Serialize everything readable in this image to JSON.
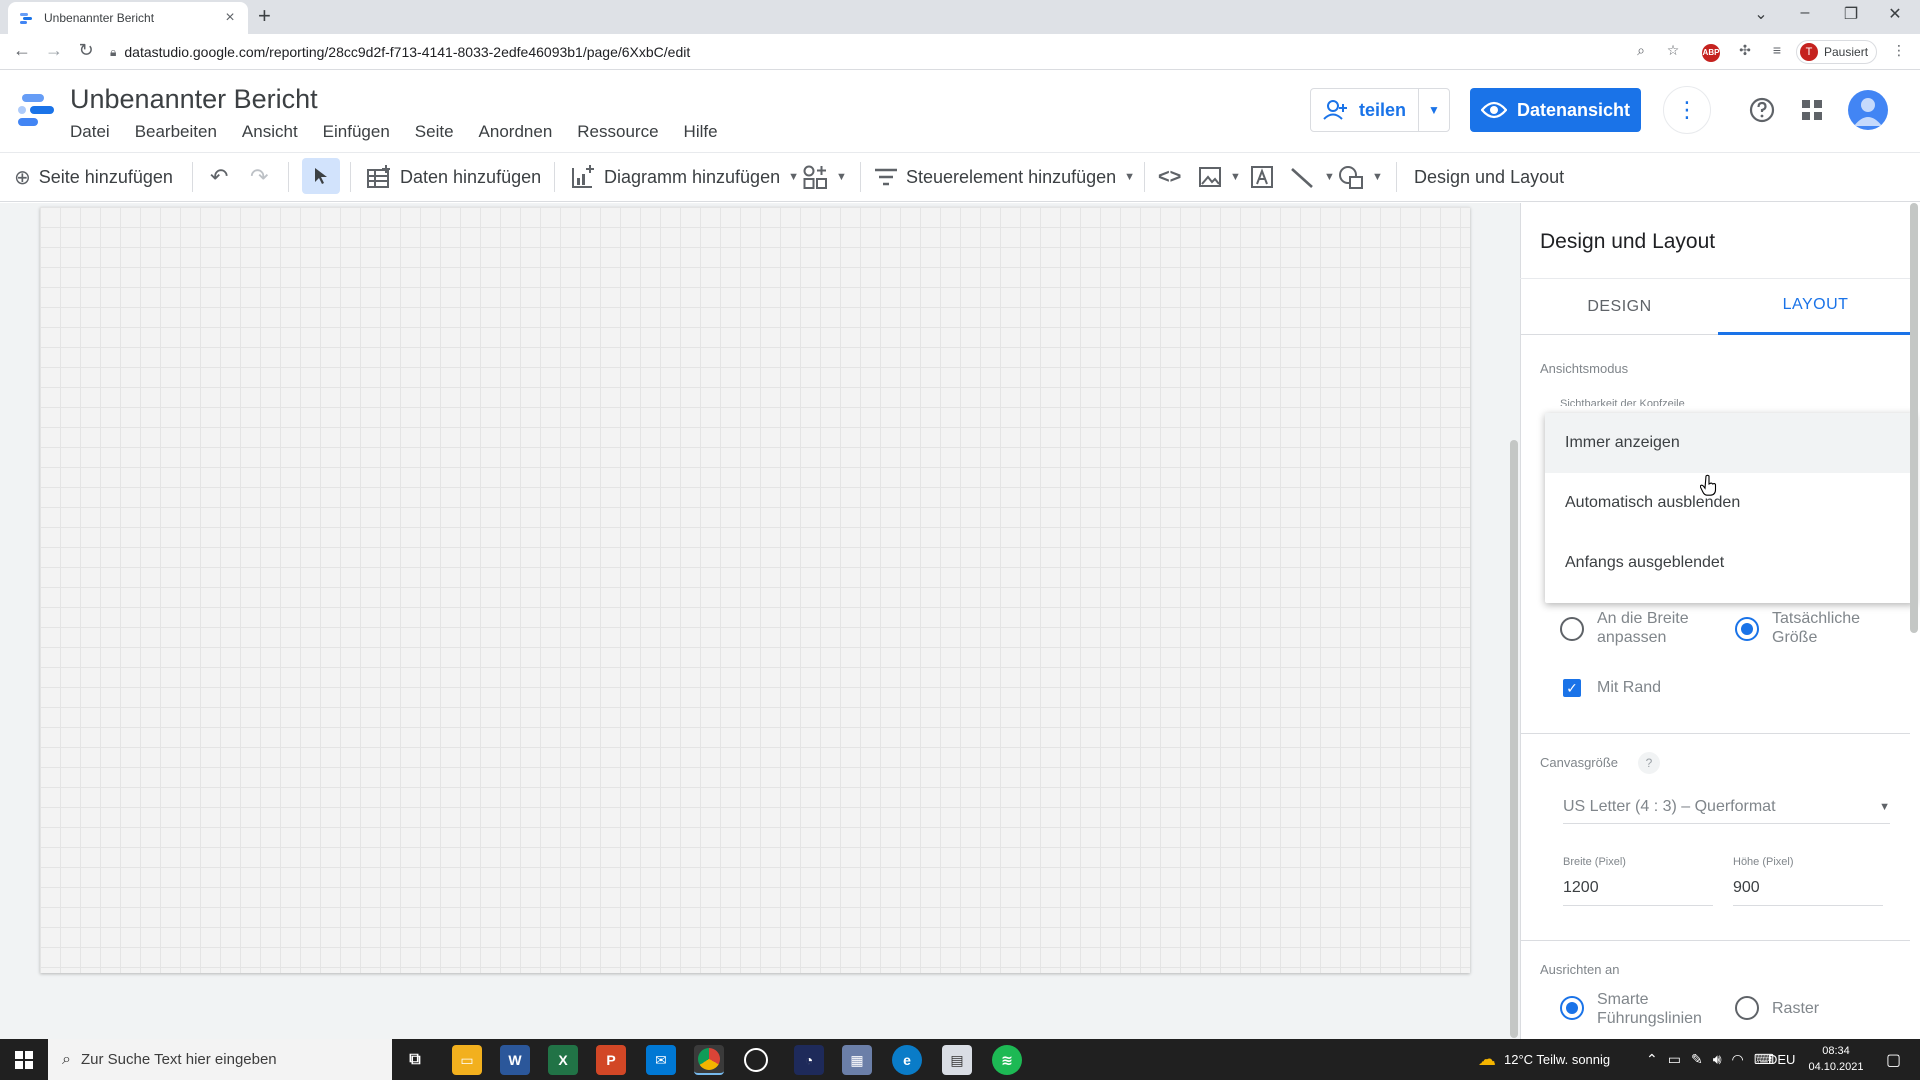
{
  "browser": {
    "tab_title": "Unbenannter Bericht",
    "url": "datastudio.google.com/reporting/28cc9d2f-f713-4141-8033-2edfe46093b1/page/6XxbC/edit",
    "profile_status": "Pausiert",
    "profile_initial": "T"
  },
  "app": {
    "report_title": "Unbenannter Bericht",
    "menu": [
      "Datei",
      "Bearbeiten",
      "Ansicht",
      "Einfügen",
      "Seite",
      "Anordnen",
      "Ressource",
      "Hilfe"
    ],
    "share_label": "teilen",
    "data_view_label": "Datenansicht"
  },
  "toolbar": {
    "add_page": "Seite hinzufügen",
    "add_data": "Daten hinzufügen",
    "add_chart": "Diagramm hinzufügen",
    "add_control": "Steuerelement hinzufügen",
    "theme_layout": "Design und Layout"
  },
  "panel": {
    "title": "Design und Layout",
    "tabs": [
      "DESIGN",
      "LAYOUT"
    ],
    "active_tab": "LAYOUT",
    "view_mode_label": "Ansichtsmodus",
    "header_visibility_label": "Sichtbarkeit der Kopfzeile",
    "dropdown_options": [
      "Immer anzeigen",
      "Automatisch ausblenden",
      "Anfangs ausgeblendet"
    ],
    "display_mode": {
      "option_fit_width": "An die Breite anpassen",
      "option_actual_size": "Tatsächliche Größe",
      "selected": "Tatsächliche Größe"
    },
    "with_border_label": "Mit Rand",
    "with_border_checked": true,
    "canvas_size_label": "Canvasgröße",
    "canvas_size_help": "?",
    "canvas_size_value": "US Letter (4 : 3) – Querformat",
    "width_label": "Breite (Pixel)",
    "width_value": "1200",
    "height_label": "Höhe (Pixel)",
    "height_value": "900",
    "align_label": "Ausrichten an",
    "align_option_smart": "Smarte Führungslinien",
    "align_option_grid": "Raster",
    "align_selected": "Smarte Führungslinien"
  },
  "taskbar": {
    "search_placeholder": "Zur Suche Text hier eingeben",
    "weather": "12°C  Teilw. sonnig",
    "language": "DEU",
    "time": "08:34",
    "date": "04.10.2021"
  },
  "colors": {
    "accent": "#1a73e8",
    "canvas_bg": "#f3f3f3",
    "taskbar": "#202020"
  }
}
